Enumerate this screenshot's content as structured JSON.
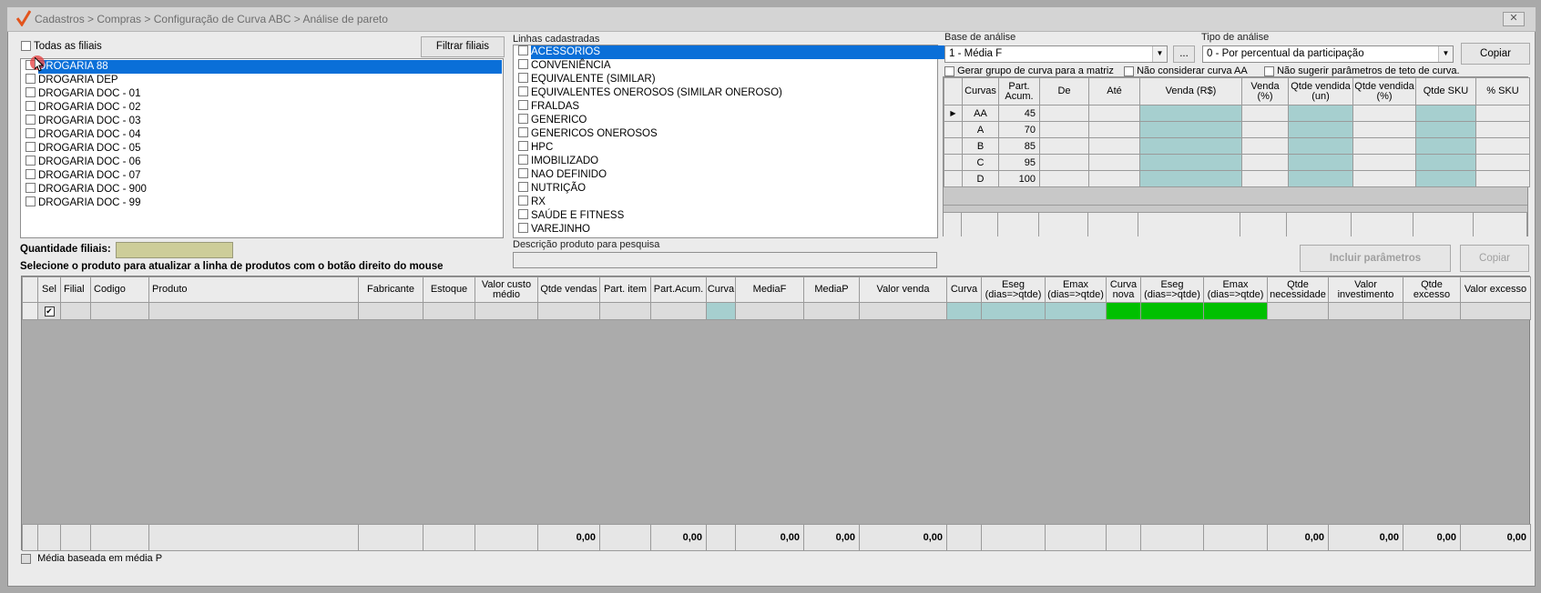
{
  "window": {
    "title": "Cadastros > Compras > Configuração de Curva ABC > Análise de pareto",
    "close_label": "✕"
  },
  "filiais": {
    "all_label": "Todas as filiais",
    "filter_button": "Filtrar filiais",
    "items": [
      "DROGARIA 88",
      "DROGARIA DEP",
      "DROGARIA DOC - 01",
      "DROGARIA DOC - 02",
      "DROGARIA DOC - 03",
      "DROGARIA DOC - 04",
      "DROGARIA DOC - 05",
      "DROGARIA DOC - 06",
      "DROGARIA DOC - 07",
      "DROGARIA DOC - 900",
      "DROGARIA DOC - 99"
    ],
    "selected_index": 0,
    "quantity_label": "Quantidade filiais:",
    "quantity_value": ""
  },
  "linhas": {
    "label": "Linhas cadastradas",
    "items": [
      "ACESSORIOS",
      "CONVENIÊNCIA",
      "EQUIVALENTE (SIMILAR)",
      "EQUIVALENTES ONEROSOS (SIMILAR ONEROSO)",
      "FRALDAS",
      "GENERICO",
      "GENERICOS ONEROSOS",
      "HPC",
      "IMOBILIZADO",
      "NAO DEFINIDO",
      "NUTRIÇÃO",
      "RX",
      "SAÚDE E FITNESS",
      "VAREJINHO"
    ],
    "selected_index": 0,
    "search_label": "Descrição produto para pesquisa",
    "search_value": ""
  },
  "analise": {
    "base_label": "Base de análise",
    "base_value": "1 - Média F",
    "ellipsis": "...",
    "tipo_label": "Tipo de análise",
    "tipo_value": "0 - Por percentual da participação",
    "copy_button": "Copiar",
    "opt_gerar": "Gerar grupo de curva para a matriz",
    "opt_nao_considerar": "Não considerar curva AA",
    "opt_nao_sugerir": "Não sugerir parâmetros de teto de curva.",
    "columns": [
      "Curvas",
      "Part. Acum.",
      "De",
      "Até",
      "Venda (R$)",
      "Venda (%)",
      "Qtde vendida (un)",
      "Qtde vendida (%)",
      "Qtde SKU",
      "% SKU"
    ],
    "rows": [
      {
        "curva": "AA",
        "part": "45"
      },
      {
        "curva": "A",
        "part": "70"
      },
      {
        "curva": "B",
        "part": "85"
      },
      {
        "curva": "C",
        "part": "95"
      },
      {
        "curva": "D",
        "part": "100"
      }
    ],
    "include_button": "Incluir parâmetros",
    "copy2_button": "Copiar"
  },
  "instruction": "Selecione o produto para atualizar a linha de produtos com o botão direito do mouse",
  "grid": {
    "columns": [
      "Sel",
      "Filial",
      "Codigo",
      "Produto",
      "Fabricante",
      "Estoque",
      "Valor custo médio",
      "Qtde vendas",
      "Part. item",
      "Part.Acum.",
      "Curva",
      "MediaF",
      "MediaP",
      "Valor venda",
      "Curva",
      "Eseg (dias=>qtde)",
      "Emax (dias=>qtde)",
      "Curva nova",
      "Eseg (dias=>qtde)",
      "Emax (dias=>qtde)",
      "Qtde necessidade",
      "Valor investimento",
      "Qtde excesso",
      "Valor excesso"
    ],
    "totals": {
      "qtde_vendas": "0,00",
      "part_acum": "0,00",
      "mediaf": "0,00",
      "mediap": "0,00",
      "valor_venda": "0,00",
      "qtde_necessidade": "0,00",
      "valor_investimento": "0,00",
      "qtde_excesso": "0,00",
      "valor_excesso": "0,00"
    }
  },
  "footer": {
    "media_label": "Média baseada em média P"
  }
}
